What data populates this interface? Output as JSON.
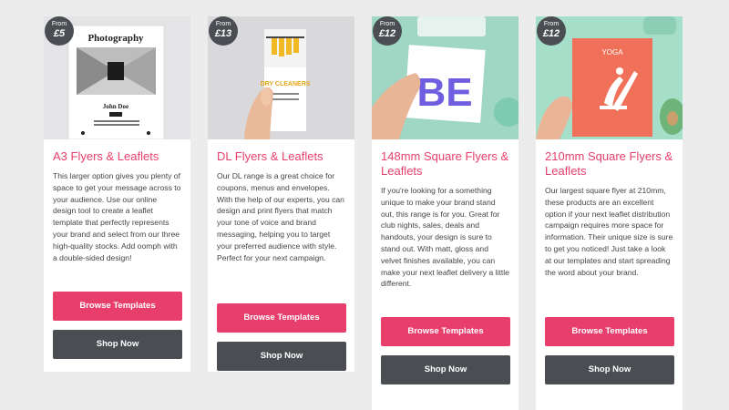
{
  "colors": {
    "accent": "#e83e6c",
    "dark_button": "#4a4d52",
    "background": "#ececec",
    "card": "#ffffff"
  },
  "cards": [
    {
      "price_from": "From",
      "price": "£5",
      "title": "A3 Flyers & Leaflets",
      "description": "This larger option gives you plenty of space to get your message across to your audience. Use our online design tool to create a leaflet template that perfectly represents your brand and select from our three high-quality stocks. Add oomph with a double-sided design!",
      "image_text": {
        "heading": "Photography",
        "name": "John Doe"
      },
      "browse_label": "Browse Templates",
      "shop_label": "Shop Now"
    },
    {
      "price_from": "From",
      "price": "£13",
      "title": "DL Flyers & Leaflets",
      "description": "Our DL range is a great choice for coupons, menus and envelopes. With the help of our experts, you can design and print flyers that match your tone of voice and brand messaging, helping you to target your preferred audience with style. Perfect for your next campaign.",
      "image_text": {
        "heading": "DRY CLEANERS"
      },
      "browse_label": "Browse Templates",
      "shop_label": "Shop Now"
    },
    {
      "price_from": "From",
      "price": "£12",
      "title": "148mm Square Flyers & Leaflets",
      "description": "If you're looking for a something unique to make your brand stand out, this range is for you. Great for club nights, sales, deals and handouts, your design is sure to stand out. With matt, gloss and velvet finishes available, you can make your next leaflet delivery a little different.",
      "image_text": {
        "heading": "BE"
      },
      "browse_label": "Browse Templates",
      "shop_label": "Shop Now"
    },
    {
      "price_from": "From",
      "price": "£12",
      "title": "210mm Square Flyers & Leaflets",
      "description": "Our largest square flyer at 210mm, these products are an excellent option if your next leaflet distribution campaign requires more space for information. Their unique size is sure to get you noticed! Just take a look at our templates and start spreading the word about your brand.",
      "image_text": {
        "heading": "YOGA"
      },
      "browse_label": "Browse Templates",
      "shop_label": "Shop Now"
    }
  ]
}
